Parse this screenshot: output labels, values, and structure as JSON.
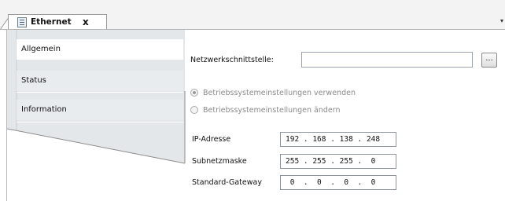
{
  "tab": {
    "title": "Ethernet",
    "close": "x",
    "menu": "▾"
  },
  "nav": {
    "items": [
      {
        "label": "Allgemein",
        "active": true
      },
      {
        "label": "Status",
        "active": false
      },
      {
        "label": "Information",
        "active": false
      }
    ]
  },
  "general": {
    "interface_label": "Netzwerkschnittstelle:",
    "interface_value": "",
    "browse_label": "...",
    "radio_use_os": "Betriebssystemeinstellungen verwenden",
    "radio_change_os": "Betriebssystemeinstellungen ändern",
    "ip_label": "IP-Adresse",
    "ip_value": "192 . 168 . 138 . 248",
    "subnet_label": "Subnetzmaske",
    "subnet_value": "255 . 255 . 255 .  0",
    "gateway_label": "Standard-Gateway",
    "gateway_value": " 0  .  0  .  0  .  0"
  }
}
